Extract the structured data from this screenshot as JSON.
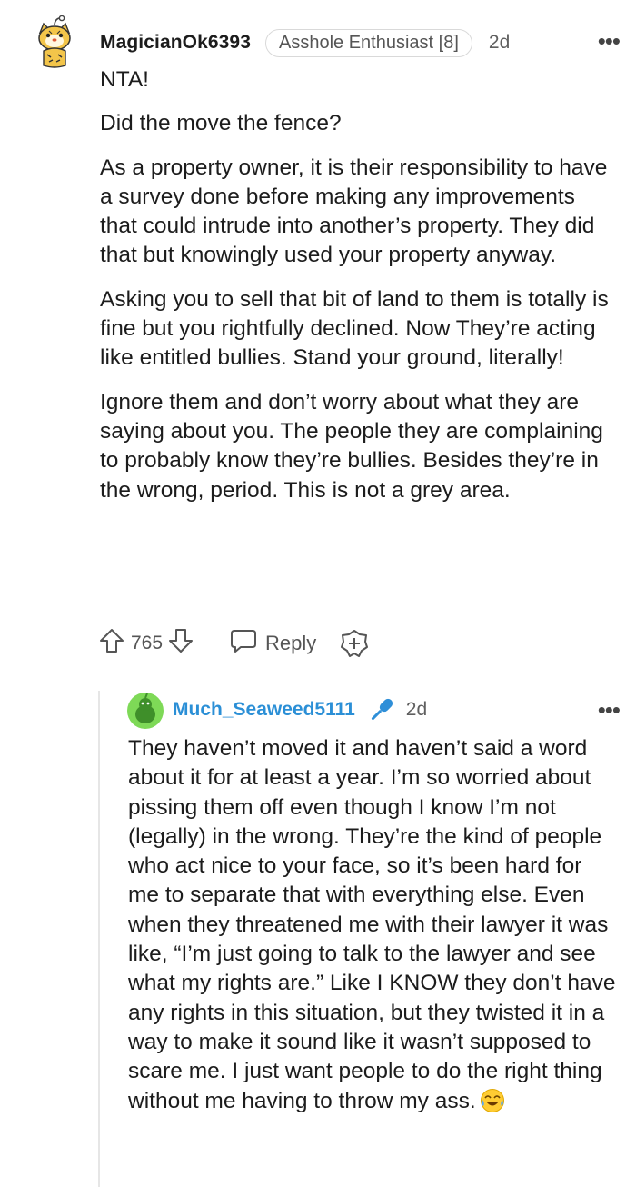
{
  "comment": {
    "username": "MagicianOk6393",
    "flair": "Asshole Enthusiast [8]",
    "age": "2d",
    "more_icon": "more-horizontal-icon",
    "paragraphs": [
      "NTA!",
      "Did the move the fence?",
      "As a property owner, it is their responsibility to have a survey done before making any improvements that could intrude into another’s property. They did that but knowingly used your property anyway.",
      "Asking you to sell that bit of land to them is totally is fine but you rightfully declined. Now They’re acting like entitled bullies. Stand your ground, literally!",
      "Ignore them and don’t worry about what they are saying about you. The people they are complaining to probably know they’re bullies. Besides they’re in the wrong, period. This is not a grey area."
    ],
    "votes": "765",
    "reply_label": "Reply"
  },
  "reply": {
    "username": "Much_Seaweed5111",
    "age": "2d",
    "more_icon": "more-horizontal-icon",
    "text": "They haven’t moved it and haven’t said a word about it for at least a year. I’m so worried about pissing them off even though I know I’m not (legally) in the wrong. They’re the kind of people who act nice to your face, so it’s been hard for me to separate that with everything else. Even when they threatened me with their lawyer it was like, “I’m just going to talk to the lawyer and see what my rights are.” Like I KNOW they don’t have any rights in this situation, but they twisted it in a way to make it sound like it wasn’t supposed to scare me. I just want people to do the right thing without me having to throw my ass.",
    "emoji": "tears-of-joy-emoji"
  },
  "colors": {
    "username_reply": "#2b8fd6",
    "mic_icon": "#2f8fd8",
    "text": "#1c1c1c",
    "meta": "#5f5f5f"
  }
}
